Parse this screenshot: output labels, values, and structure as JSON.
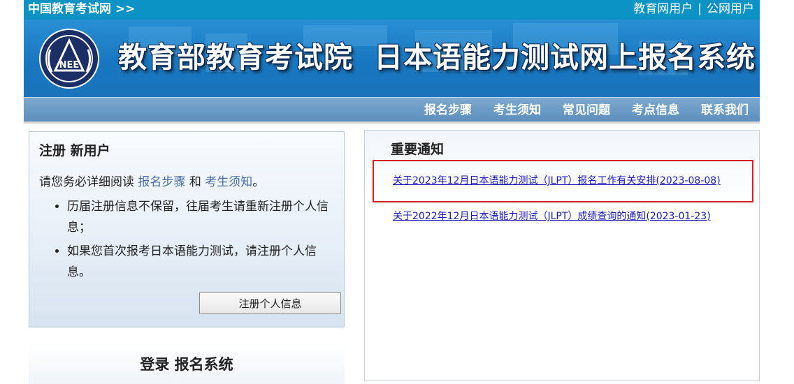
{
  "topbar": {
    "site_link": "中国教育考试网 >>",
    "user_links": [
      "教育网用户",
      "公网用户"
    ],
    "separator": "|"
  },
  "banner": {
    "title_part1": "教育部教育考试院",
    "title_part2": "日本语能力测试网上报名系统",
    "logo_text": "NEEA"
  },
  "nav": {
    "items": [
      "报名步骤",
      "考生须知",
      "常见问题",
      "考点信息",
      "联系我们"
    ]
  },
  "register": {
    "title": "注册 新用户",
    "intro_prefix": "请您务必详细阅读",
    "link_steps": "报名步骤",
    "intro_and": "和",
    "link_notes": "考生须知",
    "intro_suffix": "。",
    "bullets": [
      "历届注册信息不保留，往届考生请重新注册个人信息；",
      "如果您首次报考日本语能力测试，请注册个人信息。"
    ],
    "button_label": "注册个人信息"
  },
  "login": {
    "title": "登录 报名系统"
  },
  "notices": {
    "title": "重要通知",
    "items": [
      "关于2023年12月日本语能力测试（JLPT）报名工作有关安排(2023-08-08)",
      "关于2022年12月日本语能力测试（JLPT）成绩查询的通知(2023-01-23)"
    ]
  },
  "colors": {
    "topbar": "#0b93c6",
    "banner": "#1877c0",
    "nav": "#5d8fbd",
    "highlight_border": "#d42020",
    "link": "#1a1ab5"
  }
}
